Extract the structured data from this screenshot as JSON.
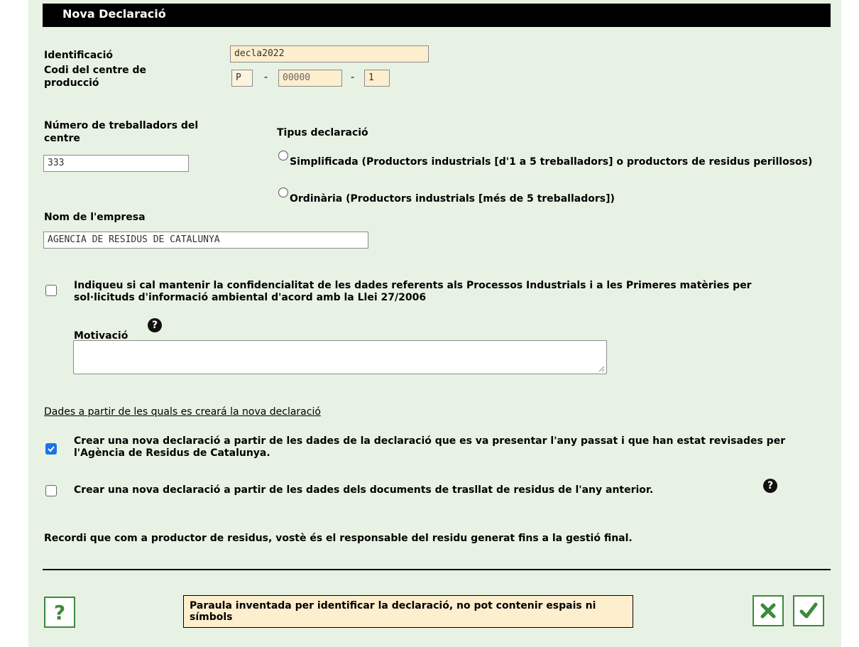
{
  "title": "Nova Declaració",
  "identification": {
    "label": "Identificació",
    "value": "decla2022"
  },
  "production_center": {
    "label": "Codi del centre de producció",
    "part1": "P",
    "part2": "00000",
    "part3": "1",
    "separator": "-"
  },
  "workers": {
    "label": "Número de treballadors del centre",
    "value": "333"
  },
  "declaration_type": {
    "label": "Tipus declaració",
    "options": [
      {
        "label": "Simplificada (Productors industrials [d'1 a 5 treballadors] o productors de residus perillosos)",
        "selected": false
      },
      {
        "label": "Ordinària (Productors industrials [més de 5 treballadors])",
        "selected": false
      }
    ]
  },
  "company": {
    "label": "Nom de l'empresa",
    "value": "AGENCIA DE RESIDUS DE CATALUNYA"
  },
  "confidentiality": {
    "label": "Indiqueu si cal mantenir la confidencialitat de les dades referents als Processos Industrials i a les Primeres matèries per sol·licituds d'informació ambiental d'acord amb la Llei 27/2006",
    "checked": false
  },
  "motivation": {
    "label": "Motivació",
    "value": ""
  },
  "source_section": {
    "heading": "Dades a partir de les quals es creará la nova declaració",
    "options": [
      {
        "label": "Crear una nova declaració a partir de les dades de la declaració que es va presentar l'any passat i que han estat revisades per l'Agència de Residus de Catalunya.",
        "checked": true
      },
      {
        "label": "Crear una nova declaració a partir de les dades dels documents de trasllat de residus de l'any anterior.",
        "checked": false
      }
    ]
  },
  "reminder": "Recordi que com a productor de residus, vostè és el responsable del residu generat fins a la gestió final.",
  "hint": "Paraula inventada per identificar la declaració, no pot contenir espais ni símbols",
  "colors": {
    "background": "#e8f2e4",
    "titlebar": "#000000",
    "field_highlight": "#fdeecd",
    "button_border": "#3c8a3c",
    "checkbox_checked": "#1a73e8"
  }
}
